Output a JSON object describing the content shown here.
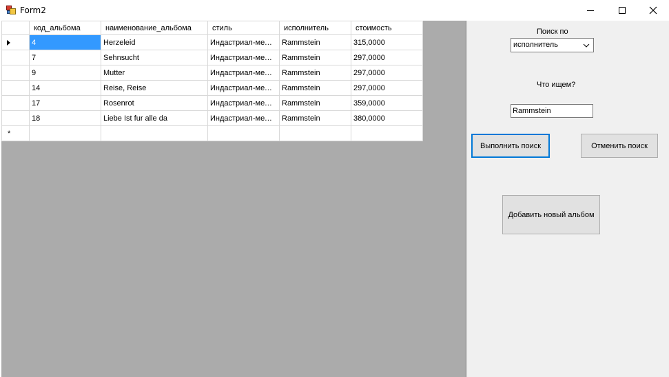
{
  "window": {
    "title": "Form2",
    "minimize_icon": "minimize-icon",
    "maximize_icon": "maximize-icon",
    "close_icon": "close-icon"
  },
  "grid": {
    "columns": [
      "код_альбома",
      "наименование_альбома",
      "стиль",
      "исполнитель",
      "стоимость"
    ],
    "rows": [
      [
        "4",
        "Herzeleid",
        "Индастриал-метал",
        "Rammstein",
        "315,0000"
      ],
      [
        "7",
        "Sehnsucht",
        "Индастриал-метал",
        "Rammstein",
        "297,0000"
      ],
      [
        "9",
        "Mutter",
        "Индастриал-метал",
        "Rammstein",
        "297,0000"
      ],
      [
        "14",
        "Reise, Reise",
        "Индастриал-метал",
        "Rammstein",
        "297,0000"
      ],
      [
        "17",
        "Rosenrot",
        "Индастриал-метал",
        "Rammstein",
        "359,0000"
      ],
      [
        "18",
        "Liebe Ist fur alle da",
        "Индастриал-метал",
        "Rammstein",
        "380,0000"
      ]
    ],
    "new_row_marker": "*",
    "selected_cell_color": "#3399ff"
  },
  "panel": {
    "search_by_label": "Поиск по",
    "search_by_value": "исполнитель",
    "what_label": "Что ищем?",
    "search_value": "Rammstein",
    "execute_button": "Выполнить поиск",
    "cancel_button": "Отменить поиск",
    "add_button": "Добавить новый альбом"
  }
}
